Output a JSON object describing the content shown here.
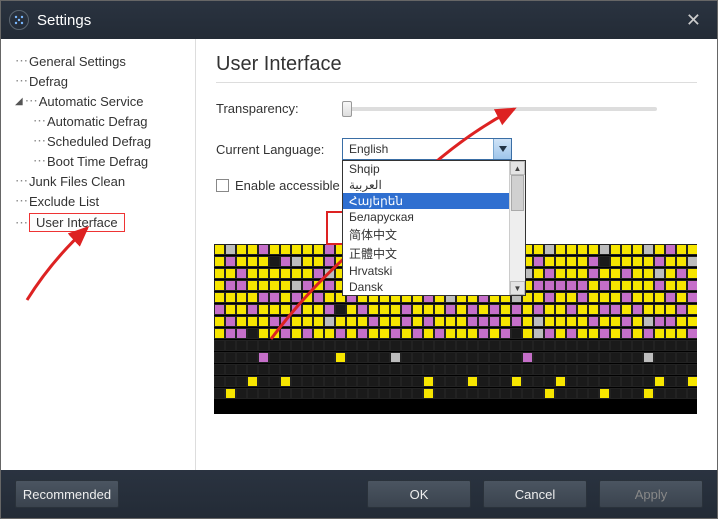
{
  "window": {
    "title": "Settings"
  },
  "sidebar": {
    "items": [
      {
        "label": "General Settings",
        "indent": false,
        "exp": ""
      },
      {
        "label": "Defrag",
        "indent": false,
        "exp": ""
      },
      {
        "label": "Automatic Service",
        "indent": false,
        "exp": "▾"
      },
      {
        "label": "Automatic Defrag",
        "indent": true,
        "exp": ""
      },
      {
        "label": "Scheduled Defrag",
        "indent": true,
        "exp": ""
      },
      {
        "label": "Boot Time Defrag",
        "indent": true,
        "exp": ""
      },
      {
        "label": "Junk Files Clean",
        "indent": false,
        "exp": ""
      },
      {
        "label": "Exclude List",
        "indent": false,
        "exp": ""
      },
      {
        "label": "User Interface",
        "indent": false,
        "exp": "",
        "selected": true
      }
    ]
  },
  "main": {
    "heading": "User Interface",
    "transparency_label": "Transparency:",
    "language_label": "Current Language:",
    "language_value": "English",
    "language_options": [
      "Shqip",
      "العربية",
      "Հայերեն",
      "Беларуская",
      "简体中文",
      "正體中文",
      "Hrvatski",
      "Dansk"
    ],
    "language_selected_index": 2,
    "accessible_label": "Enable accessible",
    "accessible_checked": false
  },
  "footer": {
    "recommended": "Recommended",
    "ok": "OK",
    "cancel": "Cancel",
    "apply": "Apply"
  },
  "colors": {
    "y": "#f7e600",
    "p": "#c56fc9",
    "g": "#bdbdbd",
    "k": "#1a1a1a"
  },
  "mosaic_rows": [
    "ygyypyyyyypyyypyygyyypyykpypyygyyyygyyygypyy",
    "ypyyykpgyypyyypyyypypypyypyyypyyyypkyyyypyyg",
    "yypyyyyyypgypypyyypyykyypppygypyyypyypyygypy",
    "yppyyyygpypyypyyyygypkyyyyppypppppypyyyypyyp",
    "yyyyppypypyypyyyyyypygyypyygyypyypyyypyyypyp",
    "pyypyyypyypkypyyypyyypypypypypyypyyppypyyypy",
    "ypyyyppyyygyyypyypypyyypppypygyyyypyypygppyy",
    "yppkyypypyypypyypypypyyypypkygpypyypypypyyyp",
    "kkkkkkkkkkkkkkkkkkkkkkkkkkkkkkkkkkkkkkkkkkkk",
    "kkkkpkkkkkkykkkkgkkkkkkkkkkkpkkkkkkkkkkgkkkk",
    "kkkkkkkkkkkkkkkkkkkkkkkkkkkkkkkkkkkkkkkkkkkk",
    "kkkykkykkkkkkkkkkkkykkkykkkykkkykkkkkkkkykky",
    "kykkkkkkkkkkkkkkkkkykkkkkkkkkkykkkkykkkykkkk"
  ]
}
